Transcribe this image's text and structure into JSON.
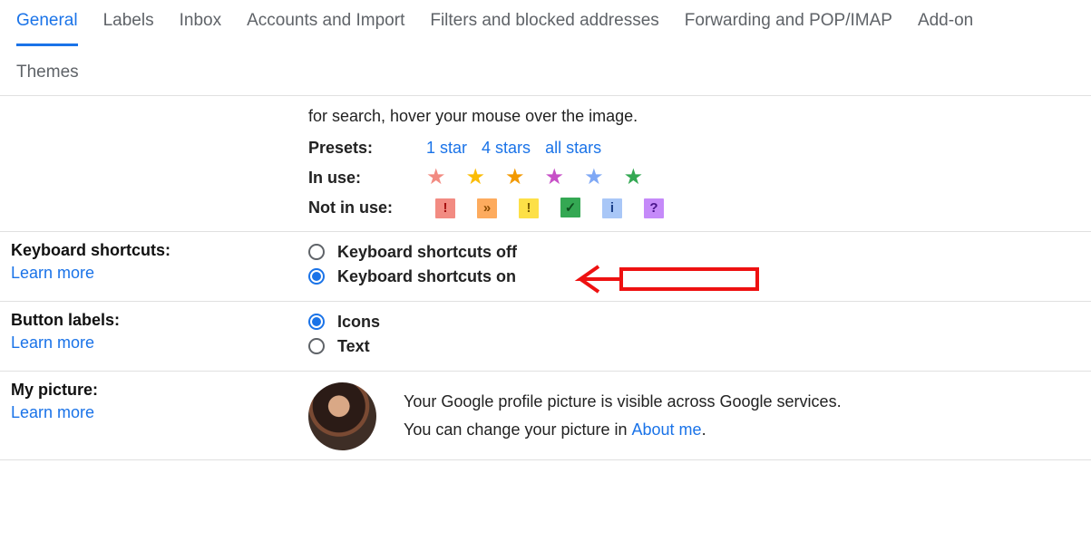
{
  "tabs": {
    "row1": [
      "General",
      "Labels",
      "Inbox",
      "Accounts and Import",
      "Filters and blocked addresses",
      "Forwarding and POP/IMAP",
      "Add-on"
    ],
    "row2": "Themes",
    "activeIndex": 0
  },
  "stars": {
    "truncated_hint": "for search, hover your mouse over the image.",
    "presets_label": "Presets:",
    "presets": [
      "1 star",
      "4 stars",
      "all stars"
    ],
    "inuse_label": "In use:",
    "inuse_colors": [
      "#f28b82",
      "#fbbc04",
      "#f29900",
      "#c750c7",
      "#7fa8f5",
      "#34a853"
    ],
    "notinuse_label": "Not in use:",
    "notinuse": [
      {
        "bg": "#f28b82",
        "fg": "#a50e0e",
        "glyph": "!"
      },
      {
        "bg": "#fdab5e",
        "fg": "#8a4a00",
        "glyph": "»"
      },
      {
        "bg": "#fde047",
        "fg": "#7a5d00",
        "glyph": "!"
      },
      {
        "bg": "#34a853",
        "fg": "#0d4f1e",
        "glyph": "✓"
      },
      {
        "bg": "#a9c7f7",
        "fg": "#1a3f8a",
        "glyph": "i"
      },
      {
        "bg": "#c58af9",
        "fg": "#4a148c",
        "glyph": "?"
      }
    ]
  },
  "keyboard": {
    "title": "Keyboard shortcuts:",
    "learn": "Learn more",
    "opts": [
      "Keyboard shortcuts off",
      "Keyboard shortcuts on"
    ],
    "selected": 1
  },
  "buttonlabels": {
    "title": "Button labels:",
    "learn": "Learn more",
    "opts": [
      "Icons",
      "Text"
    ],
    "selected": 0
  },
  "picture": {
    "title": "My picture:",
    "learn": "Learn more",
    "line1": "Your Google profile picture is visible across Google services.",
    "line2a": "You can change your picture in ",
    "about": "About me",
    "line2b": "."
  }
}
